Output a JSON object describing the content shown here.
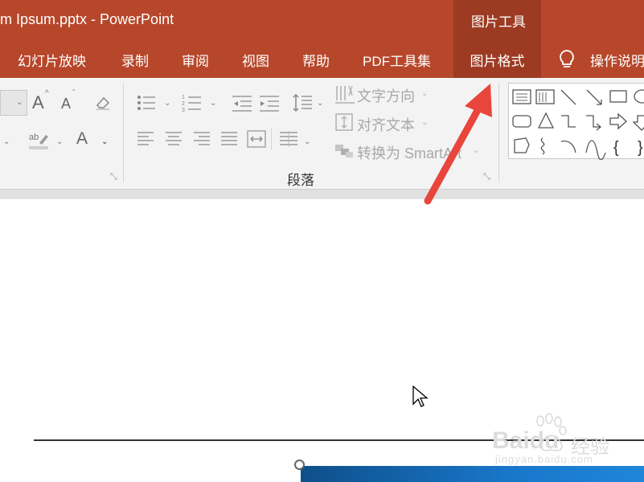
{
  "window": {
    "title": "m Ipsum.pptx  -  PowerPoint",
    "context_group": "图片工具"
  },
  "tabs": [
    {
      "label": "幻灯片放映",
      "active": false
    },
    {
      "label": "录制",
      "active": false
    },
    {
      "label": "审阅",
      "active": false
    },
    {
      "label": "视图",
      "active": false
    },
    {
      "label": "帮助",
      "active": false
    },
    {
      "label": "PDF工具集",
      "active": false
    },
    {
      "label": "图片格式",
      "active": true
    }
  ],
  "tell_me": "操作说明",
  "ribbon": {
    "paragraph": {
      "text_direction": "文字方向",
      "align_text": "对齐文本",
      "convert_smartart": "转换为 SmartArt",
      "group_label": "段落"
    },
    "font_color_glyph": "A",
    "grow_font_glyph": "A",
    "shrink_font_glyph": "A"
  },
  "watermark": {
    "brand": "Baidu",
    "sub": "经验",
    "url": "jingyan.baidu.com"
  },
  "colors": {
    "title_bar": "#b7472a",
    "context_tab": "#9c3b22",
    "ribbon": "#f3f3f3",
    "annotation_arrow": "#e8463c"
  }
}
